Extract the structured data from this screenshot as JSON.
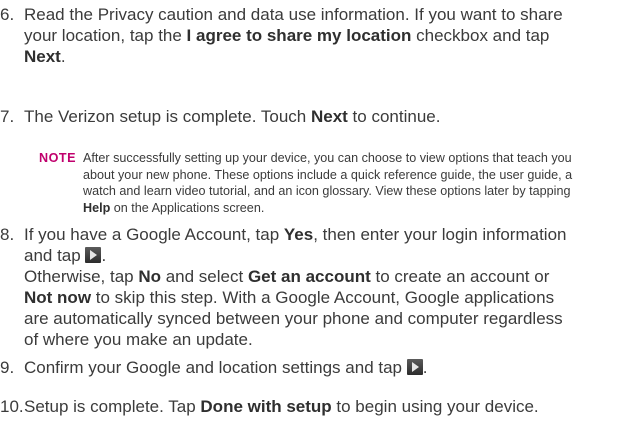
{
  "steps": {
    "s6": {
      "num": "6.",
      "a": "Read the Privacy caution and data use information. If you want to share",
      "b": "your location, tap the ",
      "b_bold": "I agree to share my location",
      "b_rest": " checkbox and tap",
      "c_bold": "Next",
      "c_rest": "."
    },
    "s7": {
      "num": "7.",
      "a": "The Verizon setup is complete. Touch ",
      "a_bold": "Next",
      "a_rest": " to continue."
    },
    "s8": {
      "num": "8.",
      "a": "If you have a Google Account, tap ",
      "a_bold": "Yes",
      "a_rest": ", then enter your login information",
      "b": "and tap ",
      "b_rest": ".",
      "c": "Otherwise, tap ",
      "c_bold1": "No",
      "c_mid": " and select ",
      "c_bold2": "Get an account",
      "c_rest": " to create an account or",
      "d_bold": "Not now",
      "d_rest": " to skip this step. With a Google Account, Google applications",
      "e": "are automatically synced between your phone and computer regardless",
      "f": "of where you make an update."
    },
    "s9": {
      "num": "9.",
      "a": "Confirm your Google and location settings and tap ",
      "a_rest": "."
    },
    "s10": {
      "num": "10.",
      "a": "Setup is complete. Tap ",
      "a_bold": "Done with setup",
      "a_rest": " to begin using your device."
    }
  },
  "note": {
    "label": "NOTE",
    "l1": "After successfully setting up your device, you can choose to view options that teach you",
    "l2": "about your new phone. These options include a quick reference guide, the user guide, a",
    "l3": "watch and learn video tutorial, and an icon glossary. View these options later by tapping",
    "l4_bold": "Help",
    "l4_rest": " on the Applications screen."
  }
}
